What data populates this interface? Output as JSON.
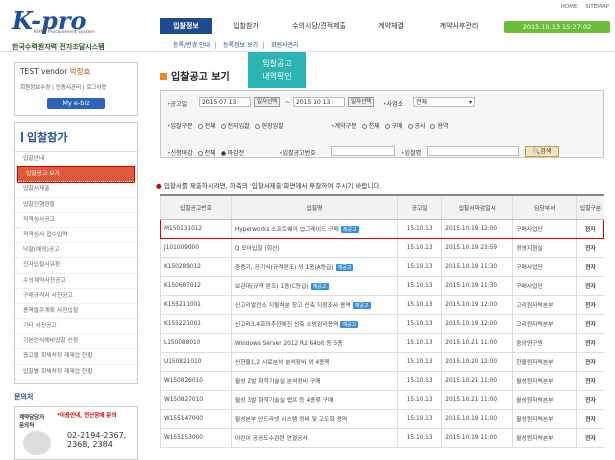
{
  "logo": {
    "brand": "K-pro",
    "en": "KHNP Procurement System",
    "kr": "한국수력원자력 전자조달시스템"
  },
  "util": [
    "HOME",
    "SITEMAP"
  ],
  "gnb": [
    "입찰정보",
    "입찰참가",
    "수의시담/견적제출",
    "계약체결",
    "계약사후관리"
  ],
  "datetime": "2015.10.13   15:27:02",
  "subnav": [
    "등록/변경 안내",
    "등록정보 보기",
    "회원사관리"
  ],
  "user": {
    "name_prefix": "TEST vendor",
    "name": "박정효",
    "links": "회원정보수정 | 인증서관리 | 로그아웃",
    "myebiz": "My e-biz"
  },
  "lnb": {
    "title": "입찰참가",
    "items": [
      "입찰안내",
      "입찰공고 보기",
      "입찰서제출",
      "입찰진행현황",
      "적격심사공고",
      "적격심사 접수입력",
      "낙찰(예정)공고",
      "전자입찰사유환",
      "수의계약사전공고",
      "구매규격서 사전공고",
      "용역발주계획 사전입찰",
      "기타 사전공고",
      "기본인식예비입찰 신청",
      "종고물 회제처정 재제업 현황",
      "입찰별 회체처정 재제업 현황"
    ],
    "selected": 1
  },
  "qna": {
    "title": "문의처",
    "a": "계약담당자 문의처",
    "b": "*이용안내, 전산장애 문의",
    "c": "02-2194-2367, 2368, 2384"
  },
  "page": {
    "title": "입찰공고 보기",
    "tooltip": [
      "입찰공고",
      "내역확인"
    ]
  },
  "search": {
    "date_label": "공고일",
    "date_from": "2015  07  13",
    "date_to": "2015  10  13",
    "date_btn": "일자선택",
    "biz_label": "사업소",
    "biz_value": "전체",
    "type_label": "입찰구분",
    "type_opts": [
      "전체",
      "전자입찰",
      "현장입찰"
    ],
    "ctype_label": "계약구분",
    "ctype_opts": [
      "전체",
      "구매",
      "공사",
      "용역"
    ],
    "close_label": "신청마감",
    "close_opts": [
      "전체",
      "마감전"
    ],
    "noticeno_label": "입찰공고번호",
    "name_label": "입찰명",
    "search_btn": "검색"
  },
  "notice": "입찰서를 제출하시려면, 하측의 '입찰서제출'화면에서 투찰하여 주시기 바랍니다.",
  "table": {
    "headers": [
      "입찰공고번호",
      "입찰명",
      "공고일",
      "입찰서마감일시",
      "담당부서",
      "입찰구분"
    ],
    "rows": [
      [
        "M150131012",
        "Hyperworks 소프트웨어 업그레이드 구매",
        "15.10.13",
        "2015.10.19 12:00",
        "구매사업단",
        "전자",
        "1"
      ],
      [
        "J101009000",
        "Q 모아입찰 (회선)",
        "15.10.13",
        "2015.10.19 23:59",
        "경영지원실",
        "전자",
        "0"
      ],
      [
        "K150289012",
        "중층기, 공기식(규격판조) 외 1종(A등급)",
        "15.10.13",
        "2015.10.19 11:30",
        "구매사업단",
        "전자",
        "1"
      ],
      [
        "K150687012",
        "보관대(규격 판조) 1종(C등급)",
        "15.10.13",
        "2015.10.19 11:30",
        "구매사업단",
        "전자",
        "1"
      ],
      [
        "K155211001",
        "신고리발전소 지혈처분 창고 신축 지점조사 용역",
        "15.10.13",
        "2015.10.19 12:00",
        "고리원자력본부",
        "전자",
        "1"
      ],
      [
        "K155221001",
        "신고리3,4호의추진에진 신축 소방감리용역",
        "15.10.13",
        "2015.10.19 12:00",
        "고리원자력본부",
        "전자",
        "1"
      ],
      [
        "L150088010",
        "Windows Server 2012 R2 64bit 등 5종",
        "15.10.13",
        "2015.10.21 11:00",
        "중앙연구원",
        "전자",
        "0"
      ],
      [
        "U150821010",
        "신한울1,2 시료분석 분석장비 외 4종목",
        "15.10.13",
        "2015.10.20 12:00",
        "한울원자력본부",
        "전자",
        "0"
      ],
      [
        "W150826010",
        "월성 2발 화학기술실 분석장비 구매",
        "15.10.13",
        "2015.10.21 11:00",
        "월성원자력본부",
        "전자",
        "0"
      ],
      [
        "W150827010",
        "월성 3발 화학기술실 랩프 등 4종류 구매",
        "15.10.13",
        "2015.10.21 11:00",
        "월성원자력본부",
        "전자",
        "0"
      ],
      [
        "W155147000",
        "월성본부 안드라넷 시스템 정비 및 고도화 용역",
        "15.10.13",
        "2015.10.19 11:00",
        "월성원자력본부",
        "전자",
        "0"
      ],
      [
        "W155153000",
        "어린이 공공도수관련 연결공사",
        "15.10.13",
        "2015.10.19 11:00",
        "월성원자력본부",
        "전자",
        "0"
      ]
    ],
    "badge": "재공고",
    "badge2": "재공고"
  },
  "colors": {
    "brand": "#1e4b8f",
    "accent": "#6cbe3a",
    "highlight": "#d00000"
  }
}
